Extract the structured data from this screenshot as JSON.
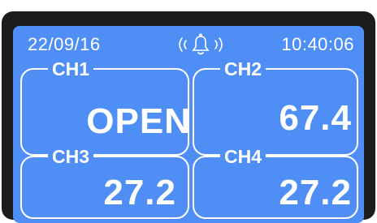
{
  "status_bar": {
    "date": "22/09/16",
    "time": "10:40:06"
  },
  "icons": {
    "alarm": "alarm-bell-icon"
  },
  "channels": [
    {
      "label": "CH1",
      "value": "OPEN"
    },
    {
      "label": "CH2",
      "value": "67.4"
    },
    {
      "label": "CH3",
      "value": "27.2"
    },
    {
      "label": "CH4",
      "value": "27.2"
    }
  ],
  "colors": {
    "screen": "#4f8ef4",
    "bezel": "#1c1c1c",
    "text": "#ffffff"
  }
}
